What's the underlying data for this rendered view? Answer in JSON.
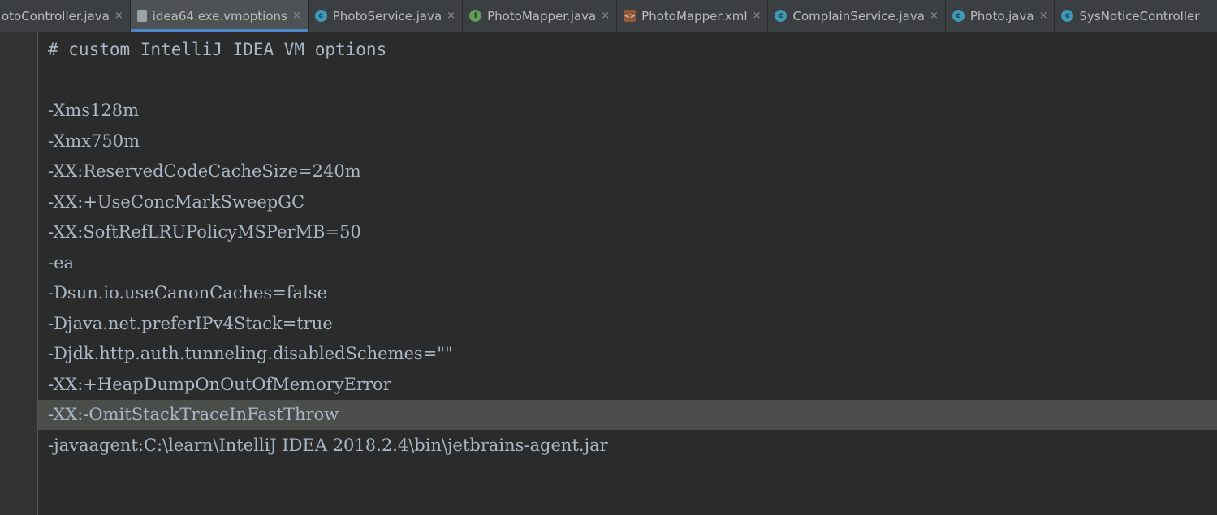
{
  "tabs": [
    {
      "label": "otoController.java",
      "icon": "class-icon",
      "icon_letter": "",
      "active": false
    },
    {
      "label": "idea64.exe.vmoptions",
      "icon": "file-icon",
      "icon_letter": "",
      "active": true
    },
    {
      "label": "PhotoService.java",
      "icon": "class-icon",
      "icon_letter": "c",
      "active": false
    },
    {
      "label": "PhotoMapper.java",
      "icon": "interface-icon",
      "icon_letter": "I",
      "active": false
    },
    {
      "label": "PhotoMapper.xml",
      "icon": "xml-icon",
      "icon_letter": "<>",
      "active": false
    },
    {
      "label": "ComplainService.java",
      "icon": "class-icon",
      "icon_letter": "c",
      "active": false
    },
    {
      "label": "Photo.java",
      "icon": "class-icon",
      "icon_letter": "c",
      "active": false
    },
    {
      "label": "SysNoticeController",
      "icon": "class-icon",
      "icon_letter": "c",
      "active": false
    }
  ],
  "close_glyph": "×",
  "editor": {
    "lines": [
      {
        "text": "# custom IntelliJ IDEA VM options",
        "kind": "comment"
      },
      {
        "text": "",
        "kind": "blank"
      },
      {
        "text": "-Xms128m",
        "kind": "option"
      },
      {
        "text": "-Xmx750m",
        "kind": "option"
      },
      {
        "text": "-XX:ReservedCodeCacheSize=240m",
        "kind": "option"
      },
      {
        "text": "-XX:+UseConcMarkSweepGC",
        "kind": "option"
      },
      {
        "text": "-XX:SoftRefLRUPolicyMSPerMB=50",
        "kind": "option"
      },
      {
        "text": "-ea",
        "kind": "option"
      },
      {
        "text": "-Dsun.io.useCanonCaches=false",
        "kind": "option"
      },
      {
        "text": "-Djava.net.preferIPv4Stack=true",
        "kind": "option"
      },
      {
        "text": "-Djdk.http.auth.tunneling.disabledSchemes=\"\"",
        "kind": "option"
      },
      {
        "text": "-XX:+HeapDumpOnOutOfMemoryError",
        "kind": "option"
      },
      {
        "text": "-XX:-OmitStackTraceInFastThrow",
        "kind": "option",
        "current": true
      },
      {
        "text": "-javaagent:C:\\learn\\IntelliJ IDEA 2018.2.4\\bin\\jetbrains-agent.jar",
        "kind": "option"
      }
    ]
  },
  "colors": {
    "background": "#2b2b2b",
    "text": "#a9b7c6",
    "current_line": "#4b4d4b",
    "tab_accent": "#4a88c7"
  }
}
